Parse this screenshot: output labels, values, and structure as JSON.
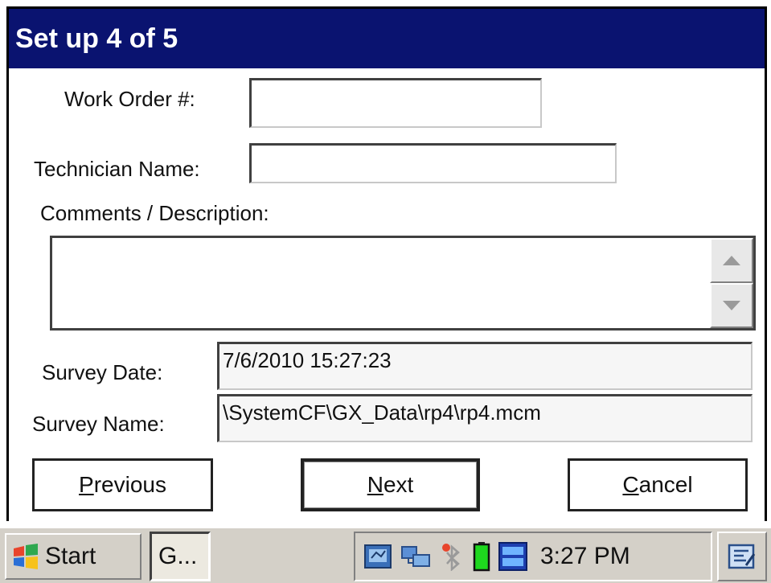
{
  "window": {
    "title": "Set up 4 of 5"
  },
  "form": {
    "work_order_label": "Work Order #:",
    "work_order_value": "",
    "technician_label": "Technician Name:",
    "technician_value": "",
    "comments_label": "Comments / Description:",
    "comments_value": "",
    "survey_date_label": "Survey Date:",
    "survey_date_value": "7/6/2010 15:27:23",
    "survey_name_label": "Survey Name:",
    "survey_name_value": "\\SystemCF\\GX_Data\\rp4\\rp4.mcm"
  },
  "buttons": {
    "previous_first": "P",
    "previous_rest": "revious",
    "next_first": "N",
    "next_rest": "ext",
    "cancel_first": "C",
    "cancel_rest": "ancel"
  },
  "taskbar": {
    "start_label": "Start",
    "task_label": "G...",
    "clock": "3:27 PM",
    "tray_icons": [
      "network-icon",
      "connection-icon",
      "bluetooth-icon",
      "battery-icon",
      "dtg-client-icon"
    ]
  },
  "colors": {
    "titlebar": "#0a1370",
    "battery": "#1ed81e"
  }
}
